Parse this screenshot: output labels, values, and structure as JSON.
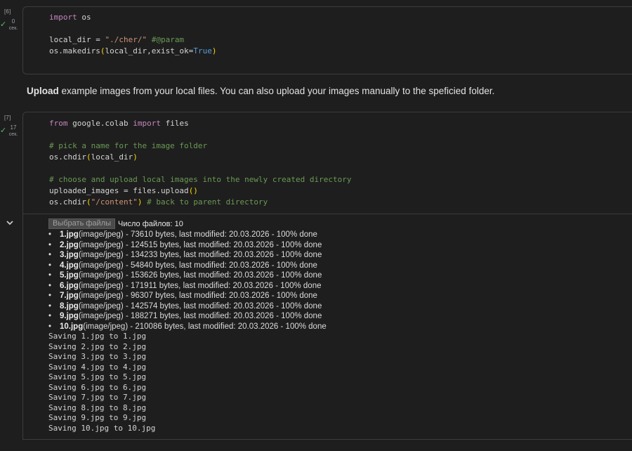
{
  "cell6": {
    "exec_count": "[6]",
    "elapsed_num": "0",
    "elapsed_unit": "сек.",
    "lines": [
      [
        {
          "t": "import",
          "c": "kw"
        },
        {
          "t": " os",
          "c": ""
        }
      ],
      [],
      [
        {
          "t": "local_dir = ",
          "c": ""
        },
        {
          "t": "\"./cher/\"",
          "c": "str"
        },
        {
          "t": " ",
          "c": ""
        },
        {
          "t": "#@param",
          "c": "cmt"
        }
      ],
      [
        {
          "t": "os.makedirs",
          "c": ""
        },
        {
          "t": "(",
          "c": "paren"
        },
        {
          "t": "local_dir,exist_ok=",
          "c": ""
        },
        {
          "t": "True",
          "c": "bool"
        },
        {
          "t": ")",
          "c": "paren"
        }
      ]
    ]
  },
  "markdown": {
    "bold": "Upload",
    "text": " example images from your local files. You can also upload your images manually to the speficied folder."
  },
  "cell7": {
    "exec_count": "[7]",
    "elapsed_num": "17",
    "elapsed_unit": "сек.",
    "lines": [
      [
        {
          "t": "from",
          "c": "kw"
        },
        {
          "t": " google.colab ",
          "c": ""
        },
        {
          "t": "import",
          "c": "kw"
        },
        {
          "t": " files",
          "c": ""
        }
      ],
      [],
      [
        {
          "t": "# pick a name for the image folder",
          "c": "cmt"
        }
      ],
      [
        {
          "t": "os.chdir",
          "c": ""
        },
        {
          "t": "(",
          "c": "paren"
        },
        {
          "t": "local_dir",
          "c": ""
        },
        {
          "t": ")",
          "c": "paren"
        }
      ],
      [],
      [
        {
          "t": "# choose and upload local images into the newly created directory",
          "c": "cmt"
        }
      ],
      [
        {
          "t": "uploaded_images = files.upload",
          "c": ""
        },
        {
          "t": "()",
          "c": "paren"
        }
      ],
      [
        {
          "t": "os.chdir",
          "c": ""
        },
        {
          "t": "(",
          "c": "paren"
        },
        {
          "t": "\"/content\"",
          "c": "str"
        },
        {
          "t": ")",
          "c": "paren"
        },
        {
          "t": " ",
          "c": ""
        },
        {
          "t": "# back to parent directory",
          "c": "cmt"
        }
      ]
    ]
  },
  "output": {
    "file_button_label": "Выбрать файлы",
    "file_count_label": "Число файлов: 10",
    "bullet": "•",
    "files": [
      {
        "name": "1.jpg",
        "details": "(image/jpeg) - 73610 bytes, last modified: 20.03.2026 - 100% done"
      },
      {
        "name": "2.jpg",
        "details": "(image/jpeg) - 124515 bytes, last modified: 20.03.2026 - 100% done"
      },
      {
        "name": "3.jpg",
        "details": "(image/jpeg) - 134233 bytes, last modified: 20.03.2026 - 100% done"
      },
      {
        "name": "4.jpg",
        "details": "(image/jpeg) - 54840 bytes, last modified: 20.03.2026 - 100% done"
      },
      {
        "name": "5.jpg",
        "details": "(image/jpeg) - 153626 bytes, last modified: 20.03.2026 - 100% done"
      },
      {
        "name": "6.jpg",
        "details": "(image/jpeg) - 171911 bytes, last modified: 20.03.2026 - 100% done"
      },
      {
        "name": "7.jpg",
        "details": "(image/jpeg) - 96307 bytes, last modified: 20.03.2026 - 100% done"
      },
      {
        "name": "8.jpg",
        "details": "(image/jpeg) - 142574 bytes, last modified: 20.03.2026 - 100% done"
      },
      {
        "name": "9.jpg",
        "details": "(image/jpeg) - 188271 bytes, last modified: 20.03.2026 - 100% done"
      },
      {
        "name": "10.jpg",
        "details": "(image/jpeg) - 210086 bytes, last modified: 20.03.2026 - 100% done"
      }
    ],
    "saving_lines": [
      "Saving 1.jpg to 1.jpg",
      "Saving 2.jpg to 2.jpg",
      "Saving 3.jpg to 3.jpg",
      "Saving 4.jpg to 4.jpg",
      "Saving 5.jpg to 5.jpg",
      "Saving 6.jpg to 6.jpg",
      "Saving 7.jpg to 7.jpg",
      "Saving 8.jpg to 8.jpg",
      "Saving 9.jpg to 9.jpg",
      "Saving 10.jpg to 10.jpg"
    ]
  },
  "icons": {
    "run_success": "check-icon",
    "collapse_output": "chevron-down-icon"
  },
  "colors": {
    "success": "#5bb974",
    "keyword": "#c586c0",
    "string": "#ce9178",
    "comment": "#6a9955",
    "boolean": "#569cd6"
  }
}
